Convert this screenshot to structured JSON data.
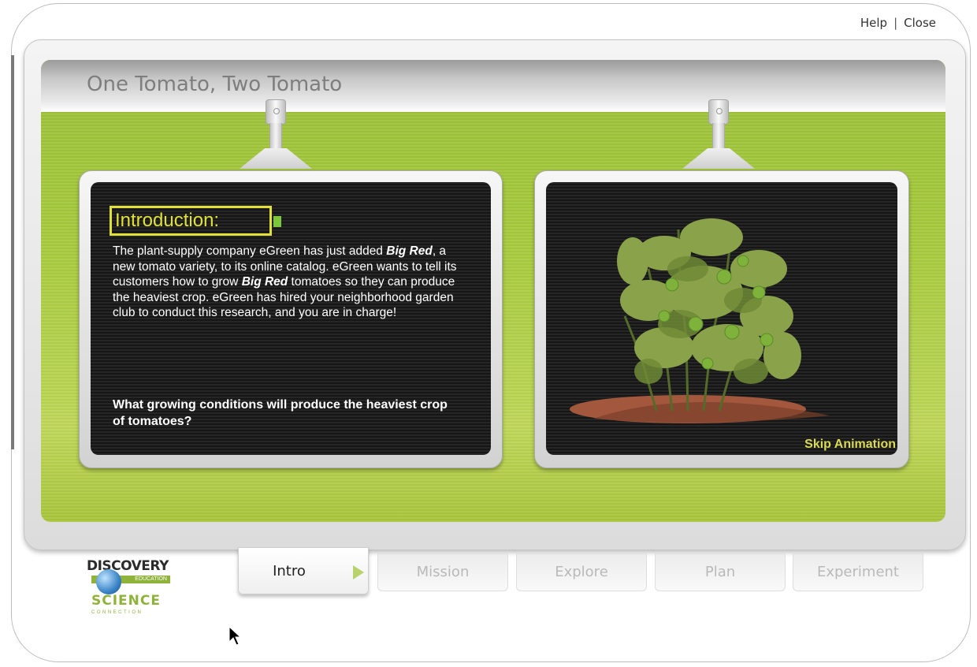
{
  "top_links": {
    "help": "Help",
    "separator": "|",
    "close": "Close"
  },
  "title": "One Tomato, Two Tomato",
  "intro": {
    "heading": "Introduction:",
    "body_parts": {
      "p1": "The plant-supply company eGreen has just added ",
      "b1": "Big Red",
      "p2": ", a new tomato variety, to its online catalog. eGreen wants to tell its customers how to grow ",
      "b2": "Big Red",
      "p3": " tomatoes so they can produce the heaviest crop. eGreen has hired your neighborhood garden club to conduct this research, and you are in charge!"
    },
    "question": "What growing conditions will produce the heaviest crop of  tomatoes?"
  },
  "animation": {
    "skip_label": "Skip Animation"
  },
  "logo": {
    "line1": "DISCOVERY",
    "edu": "EDUCATION",
    "line2": "SCIENCE",
    "line3": "CONNECTION"
  },
  "tabs": [
    {
      "label": "Intro",
      "active": true
    },
    {
      "label": "Mission",
      "active": false
    },
    {
      "label": "Explore",
      "active": false
    },
    {
      "label": "Plan",
      "active": false
    },
    {
      "label": "Experiment",
      "active": false
    }
  ],
  "colors": {
    "accent_green": "#a8cb3f",
    "heading_yellow": "#e1e036",
    "skip_yellow": "#dada55"
  }
}
